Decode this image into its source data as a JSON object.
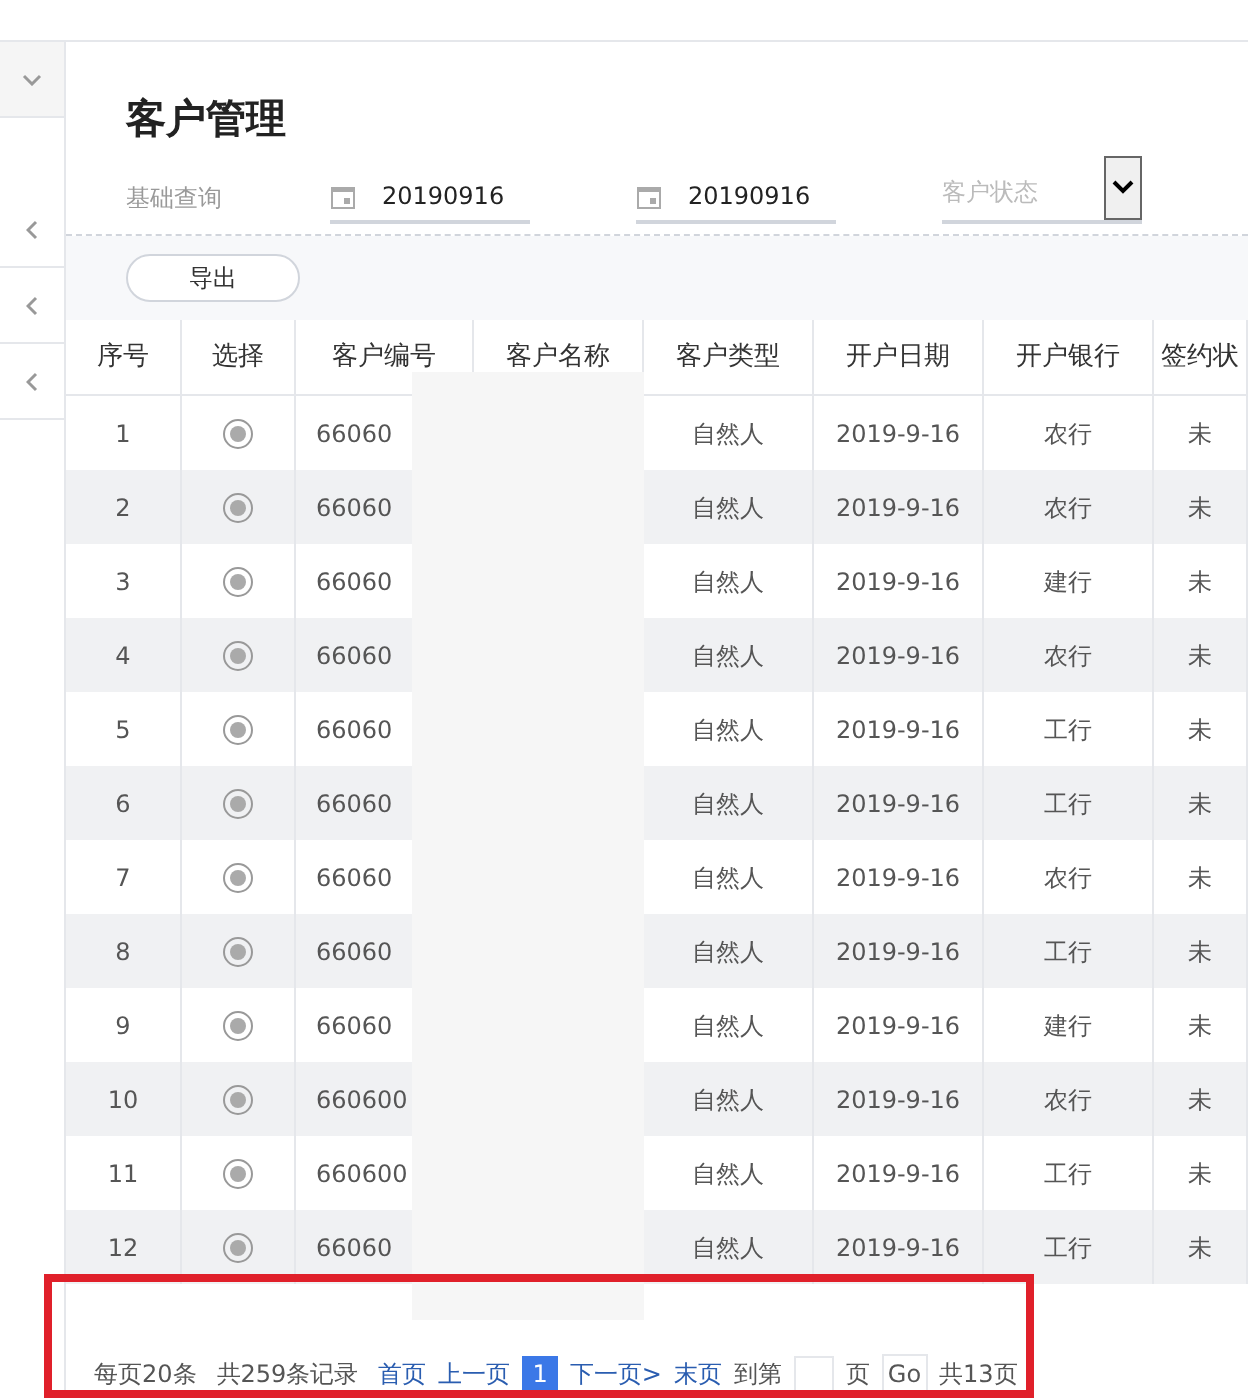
{
  "page_title": "客户管理",
  "filters": {
    "label": "基础查询",
    "start_date": "20190916",
    "end_date": "20190916",
    "status_placeholder": "客户状态"
  },
  "export_button": "导出",
  "table": {
    "columns": [
      "序号",
      "选择",
      "客户编号",
      "客户名称",
      "客户类型",
      "开户日期",
      "开户银行",
      "签约状"
    ],
    "rows": [
      {
        "index": "1",
        "customer_id": "66060",
        "type": "自然人",
        "date": "2019-9-16",
        "bank": "农行",
        "status": "未"
      },
      {
        "index": "2",
        "customer_id": "66060",
        "type": "自然人",
        "date": "2019-9-16",
        "bank": "农行",
        "status": "未"
      },
      {
        "index": "3",
        "customer_id": "66060",
        "type": "自然人",
        "date": "2019-9-16",
        "bank": "建行",
        "status": "未"
      },
      {
        "index": "4",
        "customer_id": "66060",
        "type": "自然人",
        "date": "2019-9-16",
        "bank": "农行",
        "status": "未"
      },
      {
        "index": "5",
        "customer_id": "66060",
        "type": "自然人",
        "date": "2019-9-16",
        "bank": "工行",
        "status": "未"
      },
      {
        "index": "6",
        "customer_id": "66060",
        "type": "自然人",
        "date": "2019-9-16",
        "bank": "工行",
        "status": "未"
      },
      {
        "index": "7",
        "customer_id": "66060",
        "type": "自然人",
        "date": "2019-9-16",
        "bank": "农行",
        "status": "未"
      },
      {
        "index": "8",
        "customer_id": "66060",
        "type": "自然人",
        "date": "2019-9-16",
        "bank": "工行",
        "status": "未"
      },
      {
        "index": "9",
        "customer_id": "66060",
        "type": "自然人",
        "date": "2019-9-16",
        "bank": "建行",
        "status": "未"
      },
      {
        "index": "10",
        "customer_id": "660600",
        "type": "自然人",
        "date": "2019-9-16",
        "bank": "农行",
        "status": "未"
      },
      {
        "index": "11",
        "customer_id": "660600",
        "type": "自然人",
        "date": "2019-9-16",
        "bank": "工行",
        "status": "未"
      },
      {
        "index": "12",
        "customer_id": "66060",
        "type": "自然人",
        "date": "2019-9-16",
        "bank": "工行",
        "status": "未"
      }
    ]
  },
  "pagination": {
    "per_page": "每页20条",
    "total_records": "共259条记录",
    "links": [
      {
        "label": "首页",
        "kind": "link"
      },
      {
        "label": "上一页",
        "kind": "link"
      },
      {
        "label": "1",
        "kind": "current"
      },
      {
        "label": "下一页>",
        "kind": "link"
      },
      {
        "label": "末页",
        "kind": "link"
      }
    ],
    "goto_label": "到第",
    "page_unit": "页",
    "go_button": "Go",
    "total_pages": "共13页"
  }
}
